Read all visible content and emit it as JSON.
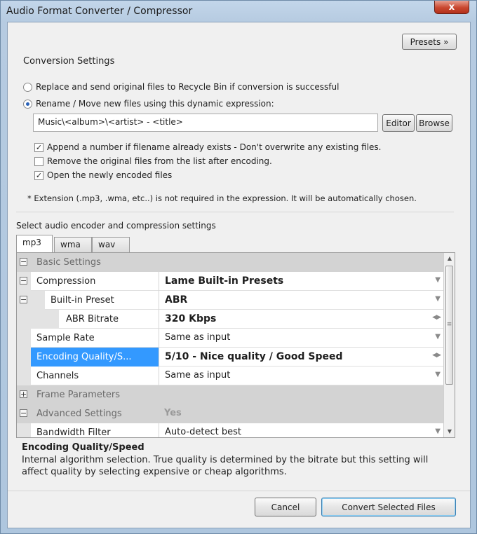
{
  "window": {
    "title": "Audio Format Converter / Compressor",
    "close_label": "x"
  },
  "presets_button": "Presets »",
  "conversion": {
    "heading": "Conversion Settings",
    "option_replace": "Replace and send original files to Recycle Bin if conversion is successful",
    "option_rename": "Rename / Move new files using this dynamic expression:",
    "expression_value": "Music\\<album>\\<artist> - <title>",
    "editor_button": "Editor",
    "browse_button": "Browse",
    "check_append": "Append a number if filename already exists - Don't overwrite any existing files.",
    "check_remove": "Remove the original files from the list after encoding.",
    "check_open": "Open the newly encoded files",
    "note": "* Extension (.mp3, .wma, etc..) is not required in the expression. It will be automatically chosen."
  },
  "encoder": {
    "heading": "Select audio encoder and compression settings",
    "tabs": [
      "mp3",
      "wma",
      "wav"
    ]
  },
  "grid": {
    "rows": [
      {
        "key": "Basic Settings",
        "value": ""
      },
      {
        "key": "Compression",
        "value": "Lame Built-in Presets"
      },
      {
        "key": "Built-in Preset",
        "value": "ABR"
      },
      {
        "key": "ABR Bitrate",
        "value": "320 Kbps"
      },
      {
        "key": "Sample Rate",
        "value": "Same as input"
      },
      {
        "key": "Encoding Quality/S...",
        "value": "5/10 - Nice quality / Good Speed"
      },
      {
        "key": "Channels",
        "value": "Same as input"
      },
      {
        "key": "Frame Parameters",
        "value": ""
      },
      {
        "key": "Advanced Settings",
        "value": "Yes"
      },
      {
        "key": "Bandwidth Filter",
        "value": "Auto-detect best"
      }
    ],
    "expand_minus": "−",
    "expand_plus": "+"
  },
  "description": {
    "title": "Encoding Quality/Speed",
    "text": "Internal algorithm selection.  True quality is determined by the bitrate but this setting will affect quality by selecting expensive or cheap algorithms."
  },
  "footer": {
    "cancel_button": "Cancel",
    "convert_button": "Convert Selected Files"
  },
  "colors": {
    "selection": "#3399ff",
    "category_row": "#d3d3d3"
  }
}
